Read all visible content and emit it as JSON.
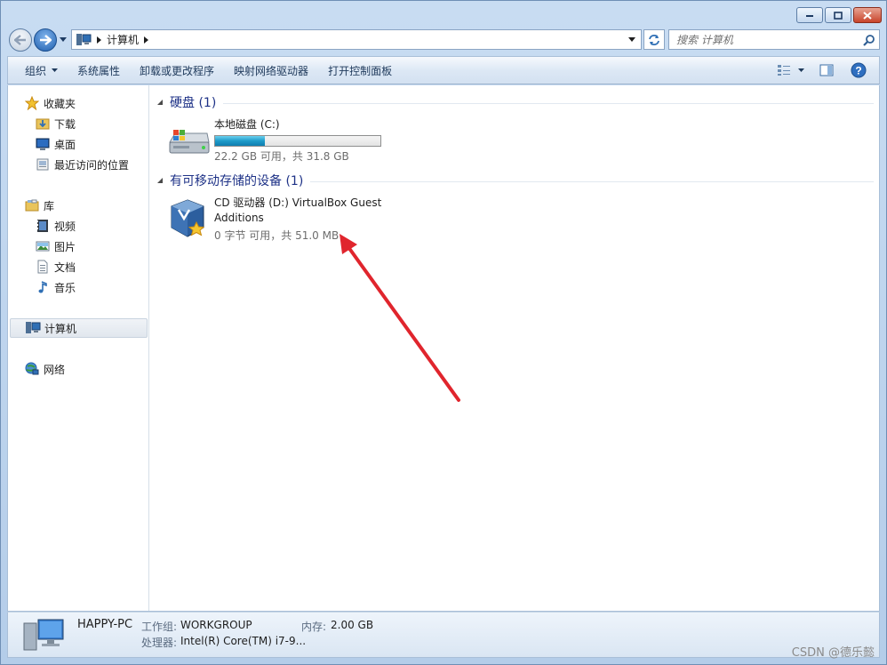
{
  "window": {
    "address": {
      "crumb": "计算机"
    },
    "search": {
      "placeholder": "搜索 计算机"
    }
  },
  "toolbar": {
    "items": [
      "组织",
      "系统属性",
      "卸载或更改程序",
      "映射网络驱动器",
      "打开控制面板"
    ]
  },
  "navpane": {
    "favorites": "收藏夹",
    "fav_items": [
      "下载",
      "桌面",
      "最近访问的位置"
    ],
    "libraries": "库",
    "lib_items": [
      "视频",
      "图片",
      "文档",
      "音乐"
    ],
    "computer": "计算机",
    "network": "网络"
  },
  "main": {
    "hard_disks": {
      "title": "硬盘 (1)",
      "drives": [
        {
          "name": "本地磁盘 (C:)",
          "free_text": "22.2 GB 可用，共 31.8 GB",
          "used_fraction": 0.3
        }
      ]
    },
    "removable": {
      "title": "有可移动存储的设备 (1)",
      "devices": [
        {
          "name": "CD 驱动器 (D:) VirtualBox Guest Additions",
          "free_text": "0 字节 可用，共 51.0 MB"
        }
      ]
    }
  },
  "details": {
    "pc_name": "HAPPY-PC",
    "workgroup_label": "工作组:",
    "workgroup_value": "WORKGROUP",
    "memory_label": "内存:",
    "memory_value": "2.00 GB",
    "processor_label": "处理器:",
    "processor_value": "Intel(R) Core(TM) i7-9..."
  },
  "watermark": "CSDN @德乐懿",
  "colors": {
    "annotation_arrow": "#e0252d",
    "group_title": "#1e3287",
    "accent": "#1e9ac9"
  }
}
